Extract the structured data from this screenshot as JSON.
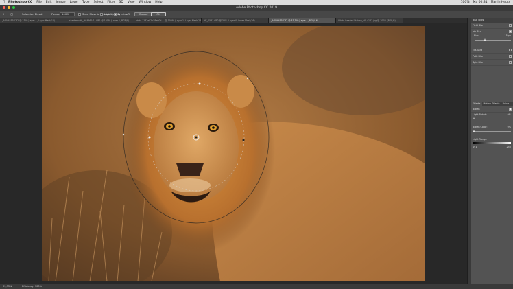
{
  "menubar": {
    "app_name": "Photoshop CC",
    "items": [
      "File",
      "Edit",
      "Image",
      "Layer",
      "Type",
      "Select",
      "Filter",
      "3D",
      "View",
      "Window",
      "Help"
    ],
    "right": [
      "100%",
      "Ma 00:31",
      "Marijn Heuts"
    ]
  },
  "window": {
    "title": "Adobe Photoshop CC 2019"
  },
  "options": {
    "selection_label": "Selection Bleed:",
    "focus_label": "Focus:",
    "focus_value": "100%",
    "save_mask_label": "Save Mask to Channels",
    "high_quality_label": "High Quality",
    "preview_label": "Preview",
    "cancel_label": "Cancel",
    "ok_label": "OK"
  },
  "tabs": [
    "_ADN4455.CR2 @ 33% (Layer 1, Layer Mask/16)",
    "sharkmouth_HC4561(1).CR2 @ 100% (Layer 1, RGB/8)",
    "data.1182e82b28e60d ... @ 100% (Layer 1, Layer Mask/16)",
    "HK_0531.CR2 @ 33% (Layer 0, Layer Mask/16)",
    "_ADN4455.CR2 @ 33,3% (Layer 1, RGB/16)",
    "White-headed Vulture_HC.4187.jpg @ 100% (RGB/8)"
  ],
  "active_tab": 4,
  "panel_top": {
    "title": "Blur Tools",
    "rows": [
      {
        "label": "Field Blur",
        "checked": false
      },
      {
        "label": "Iris Blur",
        "checked": true
      },
      {
        "label": "Tilt-Shift",
        "checked": false
      },
      {
        "label": "Path Blur",
        "checked": false
      },
      {
        "label": "Spin Blur",
        "checked": false
      }
    ],
    "blur_label": "Blur:",
    "blur_value": "15 px",
    "blur_fraction": 0.3
  },
  "panel_bottom": {
    "tabs": [
      "Effects",
      "Motion Effects",
      "Noise"
    ],
    "bokeh_label": "Bokeh",
    "light_bokeh_label": "Light Bokeh:",
    "light_bokeh_value": "0%",
    "bokeh_color_label": "Bokeh Color:",
    "bokeh_color_value": "0%",
    "light_range_label": "Light Range:",
    "range_low": "191",
    "range_high": "255"
  },
  "status": {
    "zoom": "33,33%",
    "info": "Efficiency: 100%"
  }
}
